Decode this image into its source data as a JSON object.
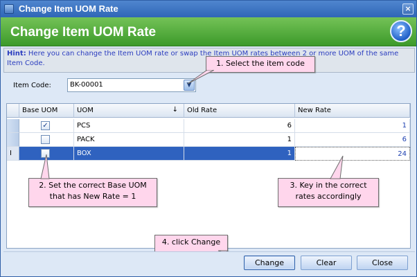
{
  "window": {
    "title": "Change Item UOM Rate",
    "close_glyph": "×"
  },
  "banner": {
    "title": "Change Item UOM Rate",
    "help_glyph": "?"
  },
  "hint": {
    "label": "Hint:",
    "text": "Here you can change the Item UOM rate or swap the Item UOM rates between 2 or more UOM of the same Item Code."
  },
  "item_code": {
    "label": "Item Code:",
    "value": "BK-00001",
    "dropdown_glyph": "▼"
  },
  "grid": {
    "columns": {
      "base_uom": "Base UOM",
      "uom": "UOM",
      "sort_glyph": "↓",
      "old_rate": "Old Rate",
      "new_rate": "New Rate"
    },
    "rows": [
      {
        "indicator": "",
        "base": "✓",
        "uom": "PCS",
        "old_rate": "6",
        "new_rate": "1"
      },
      {
        "indicator": "",
        "base": "",
        "uom": "PACK",
        "old_rate": "1",
        "new_rate": "6"
      },
      {
        "indicator": "I",
        "base": "",
        "uom": "BOX",
        "old_rate": "1",
        "new_rate": "24"
      }
    ]
  },
  "callouts": {
    "step1": "1. Select the item code",
    "step2_line1": "2. Set the correct Base UOM",
    "step2_line2": "that has New Rate = 1",
    "step3_line1": "3. Key in the correct",
    "step3_line2": "rates accordingly",
    "step4": "4. click Change"
  },
  "buttons": {
    "change": "Change",
    "clear": "Clear",
    "close": "Close"
  },
  "colors": {
    "banner": "#3c9a2a",
    "titlebar": "#2f66b7",
    "selection": "#2f62bf",
    "callout": "#ffd6ec"
  }
}
